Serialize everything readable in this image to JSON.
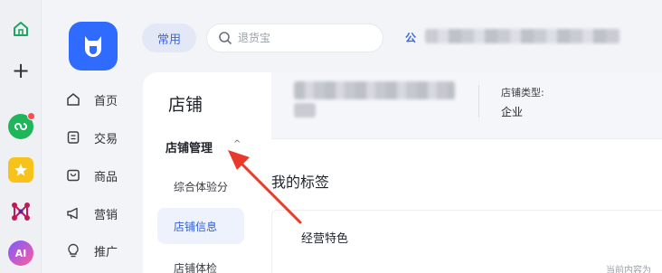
{
  "dock": {
    "items": [
      "home-icon",
      "plus-icon",
      "mini-app-icon",
      "star-icon",
      "network-icon",
      "ai-icon"
    ],
    "ai_label": "AI"
  },
  "header": {
    "common_label": "常用",
    "search_placeholder": "退货宝",
    "shop_name_prefix": "公"
  },
  "nav": {
    "items": [
      {
        "label": "首页",
        "icon": "home-icon"
      },
      {
        "label": "交易",
        "icon": "order-icon"
      },
      {
        "label": "商品",
        "icon": "bag-icon"
      },
      {
        "label": "营销",
        "icon": "megaphone-icon"
      },
      {
        "label": "推广",
        "icon": "bulb-icon"
      }
    ]
  },
  "subnav": {
    "title": "店铺",
    "group_label": "店铺管理",
    "group_caret": "^",
    "items": [
      {
        "label": "综合体验分"
      },
      {
        "label": "店铺信息"
      },
      {
        "label": "店铺体检"
      }
    ]
  },
  "info": {
    "type_label": "店铺类型:",
    "type_value": "企业"
  },
  "tags": {
    "title": "我的标签",
    "feature_label": "经营特色",
    "hint": "当前内容为"
  },
  "colors": {
    "accent": "#2f6bff",
    "annotation_arrow": "#e8392b"
  }
}
